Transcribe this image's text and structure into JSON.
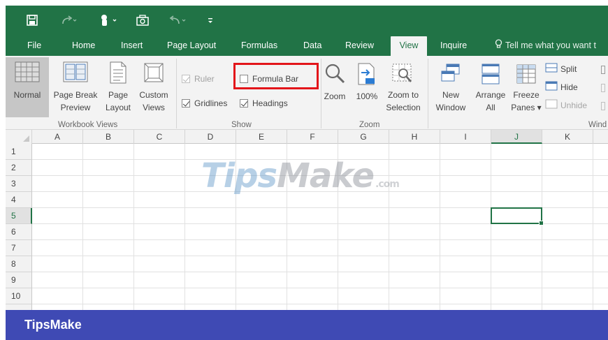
{
  "quick_access": {
    "save_icon": "save-icon",
    "redo_icon": "redo-icon",
    "touch_mode_icon": "touch-mouse-icon",
    "camera_icon": "camera-icon",
    "undo_icon": "undo-icon",
    "customize_icon": "customize-qat-icon"
  },
  "tabs": [
    "File",
    "Home",
    "Insert",
    "Page Layout",
    "Formulas",
    "Data",
    "Review",
    "View",
    "Inquire"
  ],
  "active_tab": "View",
  "tell_me": "Tell me what you want t",
  "ribbon": {
    "workbook_views": {
      "label": "Workbook Views",
      "normal": "Normal",
      "page_break_1": "Page Break",
      "page_break_2": "Preview",
      "page_layout_1": "Page",
      "page_layout_2": "Layout",
      "custom_views_1": "Custom",
      "custom_views_2": "Views"
    },
    "show": {
      "label": "Show",
      "ruler": "Ruler",
      "gridlines": "Gridlines",
      "formula_bar": "Formula Bar",
      "headings": "Headings",
      "ruler_checked": true,
      "gridlines_checked": true,
      "formula_bar_checked": false,
      "headings_checked": true
    },
    "zoom": {
      "label": "Zoom",
      "zoom": "Zoom",
      "hundred": "100%",
      "zoom_selection_1": "Zoom to",
      "zoom_selection_2": "Selection"
    },
    "window": {
      "label": "Wind",
      "new_window_1": "New",
      "new_window_2": "Window",
      "arrange_all_1": "Arrange",
      "arrange_all_2": "All",
      "freeze_panes_1": "Freeze",
      "freeze_panes_2": "Panes ▾",
      "split": "Split",
      "hide": "Hide",
      "unhide": "Unhide"
    }
  },
  "sheet": {
    "columns": [
      "A",
      "B",
      "C",
      "D",
      "E",
      "F",
      "G",
      "H",
      "I",
      "J",
      "K"
    ],
    "rows": [
      "1",
      "2",
      "3",
      "4",
      "5",
      "6",
      "7",
      "8",
      "9",
      "10"
    ],
    "active_cell": "J5"
  },
  "watermark": {
    "tips": "Tips",
    "make": "Make",
    "com": ".com"
  },
  "footer": {
    "brand": "TipsMake"
  },
  "colors": {
    "excel_green": "#217346",
    "highlight_red": "#e3151a",
    "footer_blue": "#3f4ab4"
  }
}
